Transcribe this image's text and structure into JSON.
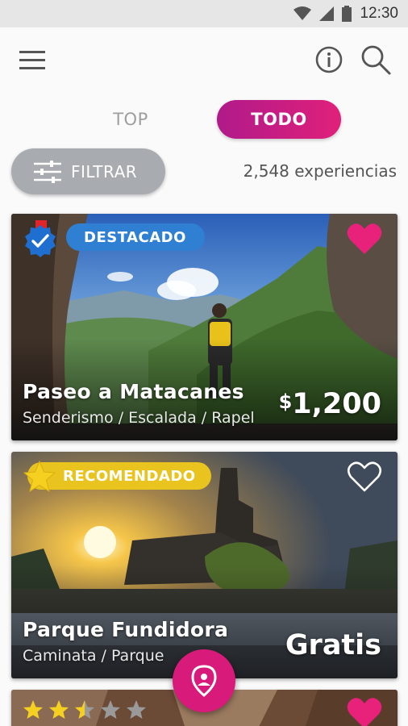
{
  "status_bar": {
    "time": "12:30",
    "icons": [
      "wifi-icon",
      "signal-icon",
      "battery-icon"
    ]
  },
  "app_bar": {
    "icons": [
      "menu-icon",
      "info-icon",
      "search-icon"
    ]
  },
  "tabs": [
    {
      "label": "TOP",
      "selected": false
    },
    {
      "label": "TODO",
      "selected": true
    }
  ],
  "filter": {
    "label": "FILTRAR",
    "icon": "sliders-icon"
  },
  "experience_count": "2,548 experiencias",
  "cards": [
    {
      "badge": "DESTACADO",
      "badge_icon": "verified-icon",
      "title": "Paseo a Matacanes",
      "subtitle": "Senderismo / Escalada / Rapel",
      "price_currency": "$",
      "price_value": "1,200",
      "favorite": true
    },
    {
      "badge": "RECOMENDADO",
      "badge_icon": "star-icon",
      "title": "Parque Fundidora",
      "subtitle": "Caminata / Parque",
      "price": "Gratis",
      "favorite": false
    },
    {
      "rating": 2.5,
      "rating_max": 5,
      "favorite": true
    }
  ],
  "fab": {
    "icon": "location-pin-icon"
  },
  "colors": {
    "accent": "#d81b7a",
    "tab_gradient_start": "#b01a8a",
    "tab_gradient_end": "#e0207a",
    "destacado_badge": "#2f7fd3",
    "recomendado_badge": "#e9c41f",
    "filter_button": "#a8acb0"
  }
}
